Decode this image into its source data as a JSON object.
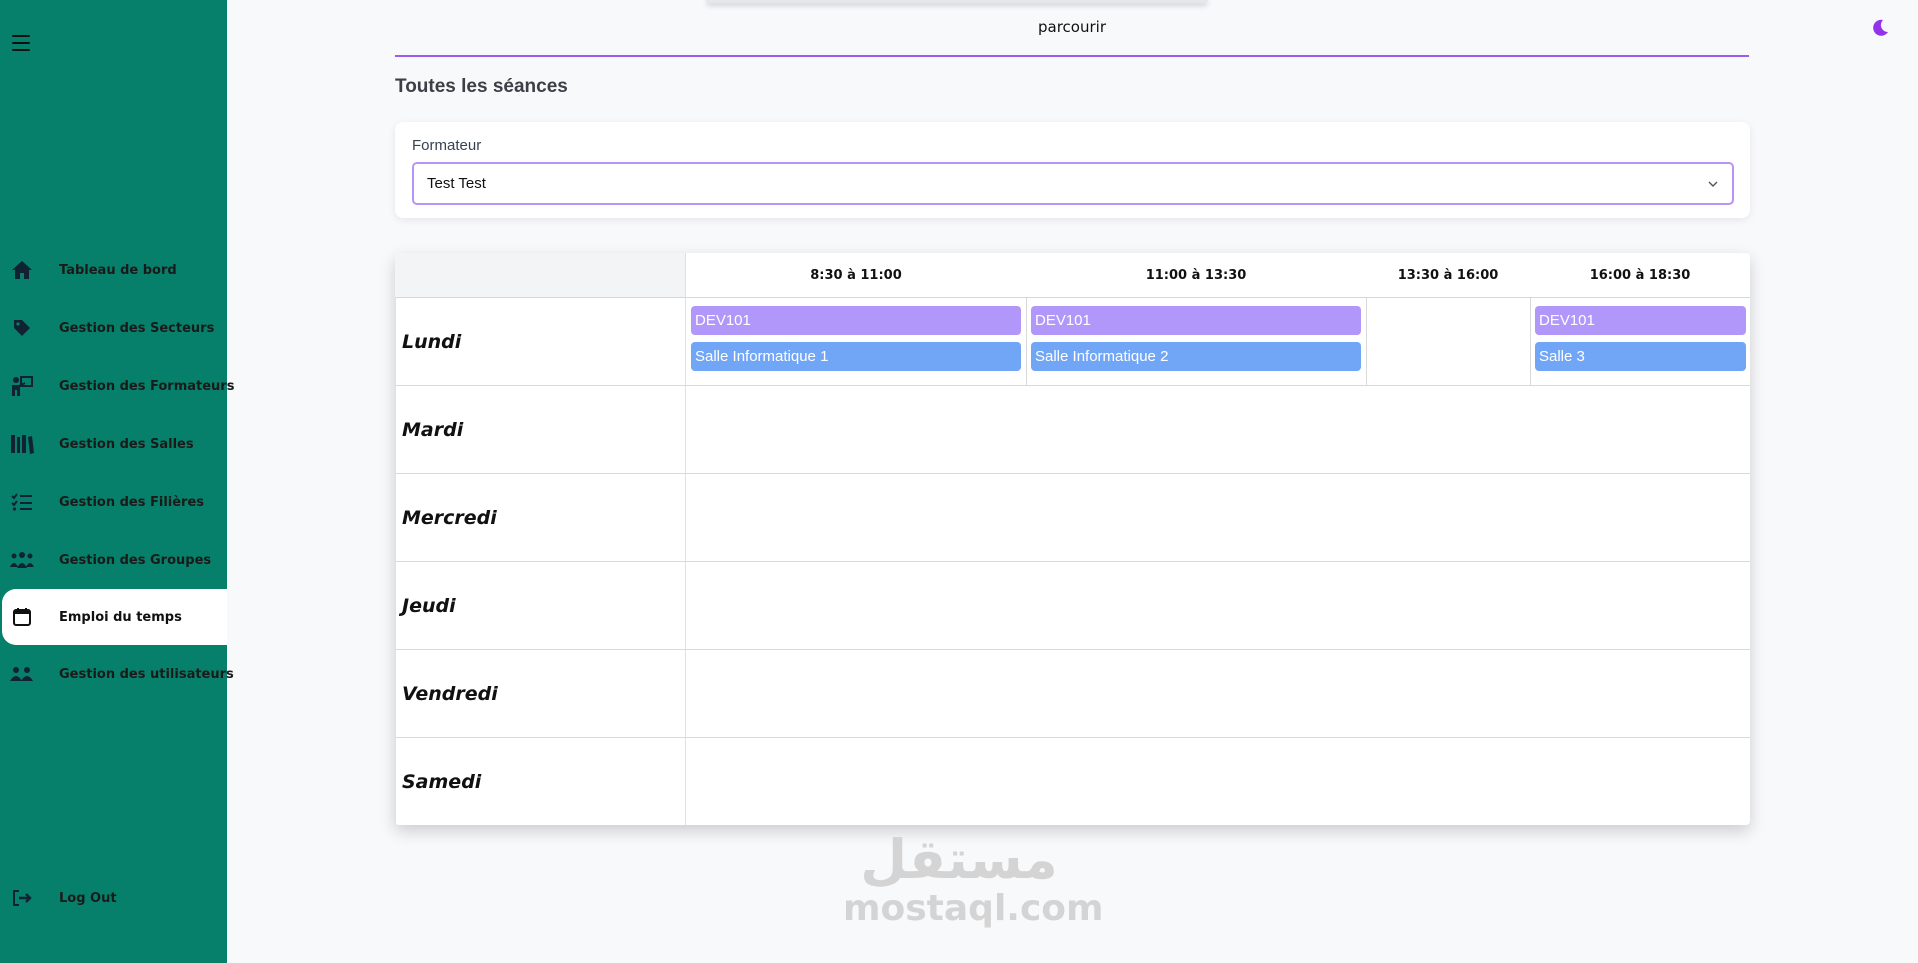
{
  "header": {
    "browse_label": "parcourir",
    "accent_color": "#9d5cf0"
  },
  "sidebar": {
    "background": "#06806a",
    "items": [
      {
        "label": "Tableau de bord",
        "icon": "home-icon"
      },
      {
        "label": "Gestion des Secteurs",
        "icon": "tag-icon"
      },
      {
        "label": "Gestion des Formateurs",
        "icon": "teacher-icon"
      },
      {
        "label": "Gestion des Salles",
        "icon": "library-icon"
      },
      {
        "label": "Gestion des Filières",
        "icon": "list-check-icon"
      },
      {
        "label": "Gestion des Groupes",
        "icon": "people-group-icon"
      },
      {
        "label": "Emploi du temps",
        "icon": "calendar-icon",
        "active": true
      },
      {
        "label": "Gestion des utilisateurs",
        "icon": "users-icon"
      }
    ],
    "logout_label": "Log Out"
  },
  "page": {
    "title": "Toutes les séances"
  },
  "filter": {
    "label": "Formateur",
    "selected": "Test Test"
  },
  "timetable": {
    "slots": [
      "8:30 à 11:00",
      "11:00 à 13:30",
      "13:30 à 16:00",
      "16:00 à 18:30"
    ],
    "days": [
      "Lundi",
      "Mardi",
      "Mercredi",
      "Jeudi",
      "Vendredi",
      "Samedi"
    ],
    "sessions": {
      "lundi_1_module": "DEV101",
      "lundi_1_room": "Salle Informatique 1",
      "lundi_2_module": "DEV101",
      "lundi_2_room": "Salle Informatique 2",
      "lundi_4_module": "DEV101",
      "lundi_4_room": "Salle 3"
    },
    "colors": {
      "module": "#b197f9",
      "room": "#71a6f7"
    }
  },
  "watermark": {
    "arabic": "مستقل",
    "latin": "mostaql.com"
  }
}
